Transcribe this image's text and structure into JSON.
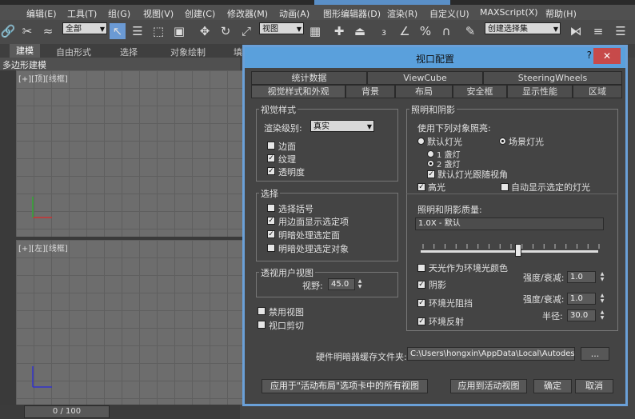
{
  "menubar": [
    "编辑(E)",
    "工具(T)",
    "组(G)",
    "视图(V)",
    "创建(C)",
    "修改器(M)",
    "动画(A)",
    "图形编辑器(D)",
    "渲染(R)",
    "自定义(U)",
    "MAXScript(X)",
    "帮助(H)"
  ],
  "toolbar": {
    "filter_value": "全部",
    "refcoord_value": "视图",
    "selection_set_value": "创建选择集"
  },
  "ribbon": {
    "tabs": [
      "建模",
      "自由形式",
      "选择",
      "对象绘制",
      "填"
    ]
  },
  "polybar": {
    "label": "多边形建模"
  },
  "viewports": {
    "top_label": "[+][顶][线框]",
    "left_label": "[+][左][线框]"
  },
  "timeline": {
    "value": "0 / 100"
  },
  "dialog": {
    "title": "视口配置",
    "help": "?",
    "close": "✕",
    "tabs_row1": [
      "统计数据",
      "ViewCube",
      "SteeringWheels"
    ],
    "tabs_row2": [
      "视觉样式和外观",
      "背景",
      "布局",
      "安全框",
      "显示性能",
      "区域"
    ],
    "visual_style": {
      "title": "视觉样式",
      "render_level_label": "渲染级别:",
      "render_level_value": "真实",
      "edged_faces": "边面",
      "textures": "纹理",
      "transparency": "透明度"
    },
    "selection": {
      "title": "选择",
      "selection_brackets": "选择括号",
      "shade_selected_edges": "用边面显示选定项",
      "shade_selected_faces": "明暗处理选定面",
      "shade_selected_objects": "明暗处理选定对象"
    },
    "perspective": {
      "title": "透视用户视图",
      "fov_label": "视野:",
      "fov_value": "45.0"
    },
    "disable_view": "禁用视图",
    "viewport_clipping": "视口剪切",
    "lighting": {
      "title": "照明和阴影",
      "illuminate_label": "使用下列对象照亮:",
      "default_lights": "默认灯光",
      "scene_lights": "场景灯光",
      "one_light": "1 盏灯",
      "two_lights": "2 盏灯",
      "default_follow": "默认灯光跟随视角",
      "highlights": "高光",
      "auto_display": "自动显示选定的灯光",
      "quality_label": "照明和阴影质量:",
      "quality_value": "1.0X - 默认",
      "sky_ambient": "天光作为环境光颜色",
      "shadows": "阴影",
      "ambient_occlusion": "环境光阻挡",
      "ambient_reflect": "环境反射",
      "intensity_label_1": "强度/衰减:",
      "intensity_value_1": "1.0",
      "intensity_label_2": "强度/衰减:",
      "intensity_value_2": "1.0",
      "radius_label": "半径:",
      "radius_value": "30.0",
      "quality_slider_fraction": 0.55
    },
    "cache_label": "硬件明暗器缓存文件夹:",
    "cache_path": "C:\\Users\\hongxin\\AppData\\Local\\Autodesk\\3dsMax\\",
    "browse": "...",
    "apply_all": "应用于\"活动布局\"选项卡中的所有视图",
    "apply_active": "应用到活动视图",
    "ok": "确定",
    "cancel": "取消"
  }
}
